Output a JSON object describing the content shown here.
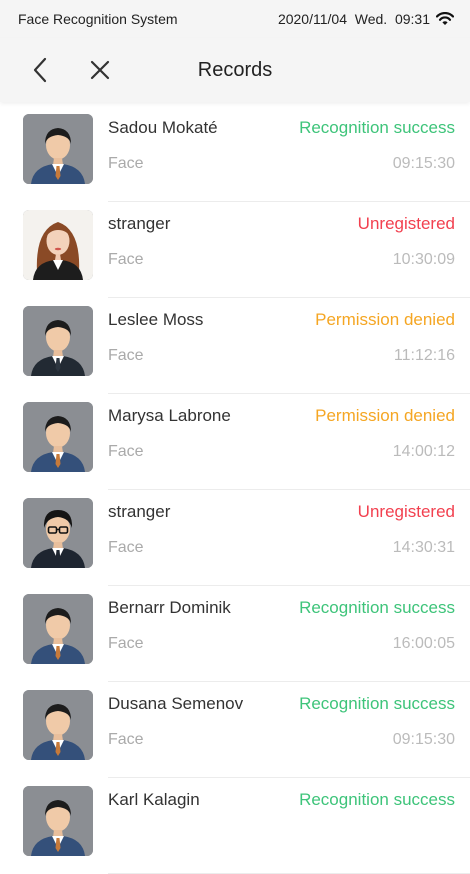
{
  "status_bar": {
    "app_name": "Face Recognition System",
    "datetime": "2020/11/04  Wed.  09:31"
  },
  "nav": {
    "back_icon": "chevron-left",
    "close_icon": "close-x",
    "title": "Records"
  },
  "status_colors": {
    "success": "#3ec47a",
    "unregistered": "#f2404f",
    "denied": "#f5a623"
  },
  "records": [
    {
      "name": "Sadou Mokaté",
      "status": "Recognition success",
      "status_type": "success",
      "method": "Face",
      "time": "09:15:30",
      "avatar": "man-blue-suit"
    },
    {
      "name": "stranger",
      "status": "Unregistered",
      "status_type": "unregistered",
      "method": "Face",
      "time": "10:30:09",
      "avatar": "woman-long-hair"
    },
    {
      "name": "Leslee Moss",
      "status": "Permission denied",
      "status_type": "denied",
      "method": "Face",
      "time": "11:12:16",
      "avatar": "man-dark-suit"
    },
    {
      "name": "Marysa Labrone",
      "status": "Permission denied",
      "status_type": "denied",
      "method": "Face",
      "time": "14:00:12",
      "avatar": "man-blue-suit"
    },
    {
      "name": "stranger",
      "status": "Unregistered",
      "status_type": "unregistered",
      "method": "Face",
      "time": "14:30:31",
      "avatar": "man-glasses"
    },
    {
      "name": "Bernarr Dominik",
      "status": "Recognition success",
      "status_type": "success",
      "method": "Face",
      "time": "16:00:05",
      "avatar": "man-blue-suit"
    },
    {
      "name": "Dusana Semenov",
      "status": "Recognition success",
      "status_type": "success",
      "method": "Face",
      "time": "09:15:30",
      "avatar": "man-blue-suit"
    },
    {
      "name": "Karl Kalagin",
      "status": "Recognition success",
      "status_type": "success",
      "method": "",
      "time": "",
      "avatar": "man-blue-suit"
    }
  ]
}
